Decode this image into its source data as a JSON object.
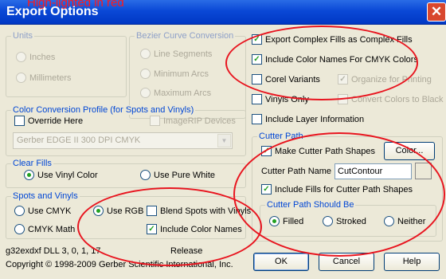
{
  "window": {
    "title": "Export Options",
    "close_glyph": "✕",
    "annotation": "High-lighted in red"
  },
  "units": {
    "legend": "Units",
    "inches": "Inches",
    "millimeters": "Millimeters"
  },
  "bezier": {
    "legend": "Bezier Curve Conversion",
    "line_segments": "Line Segments",
    "minimum_arcs": "Minimum Arcs",
    "maximum_arcs": "Maximum Arcs"
  },
  "color_profile": {
    "legend": "Color Conversion Profile (for Spots and Vinyls)",
    "override_here": "Override Here",
    "imagerip_devices": "ImageRIP Devices",
    "profile_value": "Gerber EDGE II 300 DPI CMYK"
  },
  "clear_fills": {
    "legend": "Clear Fills",
    "use_vinyl_color": "Use Vinyl Color",
    "use_pure_white": "Use Pure White"
  },
  "spots": {
    "legend": "Spots and Vinyls",
    "use_cmyk": "Use CMYK",
    "use_rgb": "Use RGB",
    "cmyk_math": "CMYK Math",
    "blend_spots": "Blend Spots with Vinyls",
    "include_color_names": "Include Color Names"
  },
  "options": {
    "export_complex_fills": "Export Complex Fills as Complex Fills",
    "include_cmyk_names": "Include Color Names For CMYK Colors",
    "corel_variants": "Corel Variants",
    "organize_printing": "Organize for Printing",
    "vinyls_only": "Vinyls Only",
    "convert_black": "Convert Colors to Black",
    "include_layer_info": "Include Layer Information"
  },
  "cutter": {
    "legend": "Cutter Path",
    "make_shapes": "Make Cutter Path Shapes",
    "color_button": "Color...",
    "name_label": "Cutter Path Name",
    "name_value": "CutContour",
    "include_fills": "Include Fills for Cutter Path Shapes",
    "should_be_legend": "Cutter Path Should Be",
    "filled": "Filled",
    "stroked": "Stroked",
    "neither": "Neither"
  },
  "footer": {
    "version": "g32exdxf DLL 3, 0, 1, 17",
    "release": "Release",
    "copyright": "Copyright © 1998-2009 Gerber Scientific International, Inc.",
    "ok": "OK",
    "cancel": "Cancel",
    "help": "Help"
  },
  "colors": {
    "titlebar": "#0a48d6",
    "group_legend": "#0046d5",
    "annotation_red": "#e8151f",
    "check_green": "#21a121",
    "dialog_bg": "#ece9d8"
  },
  "icons": [
    "close-icon",
    "dropdown-arrow-icon"
  ]
}
